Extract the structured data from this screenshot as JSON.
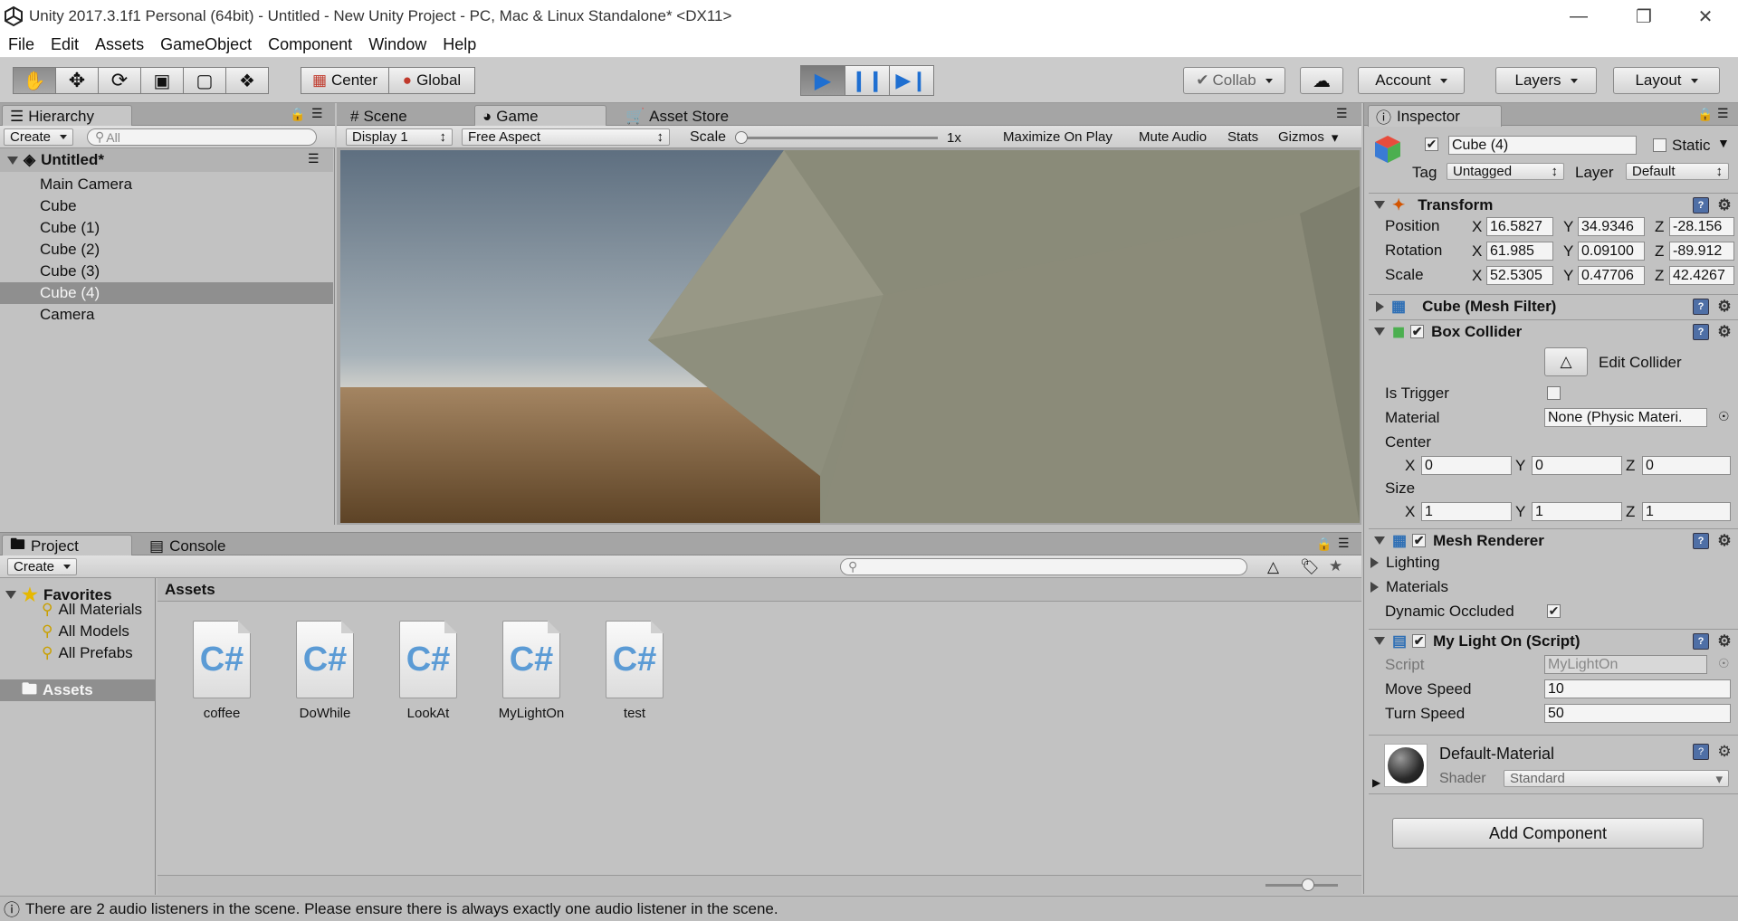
{
  "window": {
    "title": "Unity 2017.3.1f1 Personal (64bit) - Untitled - New Unity Project - PC, Mac & Linux Standalone* <DX11>"
  },
  "menu": [
    "File",
    "Edit",
    "Assets",
    "GameObject",
    "Component",
    "Window",
    "Help"
  ],
  "toolbar": {
    "center": "Center",
    "global": "Global",
    "collab": "Collab",
    "account": "Account",
    "layers": "Layers",
    "layout": "Layout"
  },
  "hierarchy": {
    "tab": "Hierarchy",
    "create": "Create",
    "search_placeholder": "All",
    "scene": "Untitled*",
    "items": [
      "Main Camera",
      "Cube",
      "Cube (1)",
      "Cube (2)",
      "Cube (3)",
      "Cube (4)",
      "Camera"
    ],
    "selected_index": 5
  },
  "view_tabs": {
    "scene": "Scene",
    "game": "Game",
    "asset_store": "Asset Store"
  },
  "game_toolbar": {
    "display": "Display 1",
    "aspect": "Free Aspect",
    "scale_label": "Scale",
    "scale_value": "1x",
    "maximize": "Maximize On Play",
    "mute": "Mute Audio",
    "stats": "Stats",
    "gizmos": "Gizmos"
  },
  "project": {
    "tab": "Project",
    "console_tab": "Console",
    "create": "Create",
    "favorites": "Favorites",
    "fav_items": [
      "All Materials",
      "All Models",
      "All Prefabs"
    ],
    "assets_root": "Assets",
    "assets_header": "Assets",
    "files": [
      "coffee",
      "DoWhile",
      "LookAt",
      "MyLightOn",
      "test"
    ],
    "file_glyph": "C#"
  },
  "inspector": {
    "tab": "Inspector",
    "object_name": "Cube (4)",
    "static_label": "Static",
    "tag_label": "Tag",
    "tag_value": "Untagged",
    "layer_label": "Layer",
    "layer_value": "Default",
    "transform": {
      "title": "Transform",
      "position_label": "Position",
      "rotation_label": "Rotation",
      "scale_label": "Scale",
      "position": [
        "16.5827",
        "34.9346",
        "-28.156"
      ],
      "rotation": [
        "61.985",
        "0.09100",
        "-89.912"
      ],
      "scale": [
        "52.5305",
        "0.47706",
        "42.4267"
      ]
    },
    "mesh_filter": {
      "title": "Cube (Mesh Filter)"
    },
    "box_collider": {
      "title": "Box Collider",
      "edit_collider": "Edit Collider",
      "is_trigger": "Is Trigger",
      "material_label": "Material",
      "material_value": "None (Physic Materi.",
      "center_label": "Center",
      "size_label": "Size",
      "center": [
        "0",
        "0",
        "0"
      ],
      "size": [
        "1",
        "1",
        "1"
      ]
    },
    "mesh_renderer": {
      "title": "Mesh Renderer",
      "lighting": "Lighting",
      "materials": "Materials",
      "dynamic_occluded": "Dynamic Occluded"
    },
    "script": {
      "title": "My Light On (Script)",
      "script_label": "Script",
      "script_value": "MyLightOn",
      "move_speed_label": "Move Speed",
      "move_speed": "10",
      "turn_speed_label": "Turn Speed",
      "turn_speed": "50"
    },
    "material": {
      "name": "Default-Material",
      "shader_label": "Shader",
      "shader_value": "Standard"
    },
    "add_component": "Add Component",
    "axes": [
      "X",
      "Y",
      "Z"
    ]
  },
  "status": {
    "message": "There are 2 audio listeners in the scene. Please ensure there is always exactly one audio listener in the scene."
  }
}
